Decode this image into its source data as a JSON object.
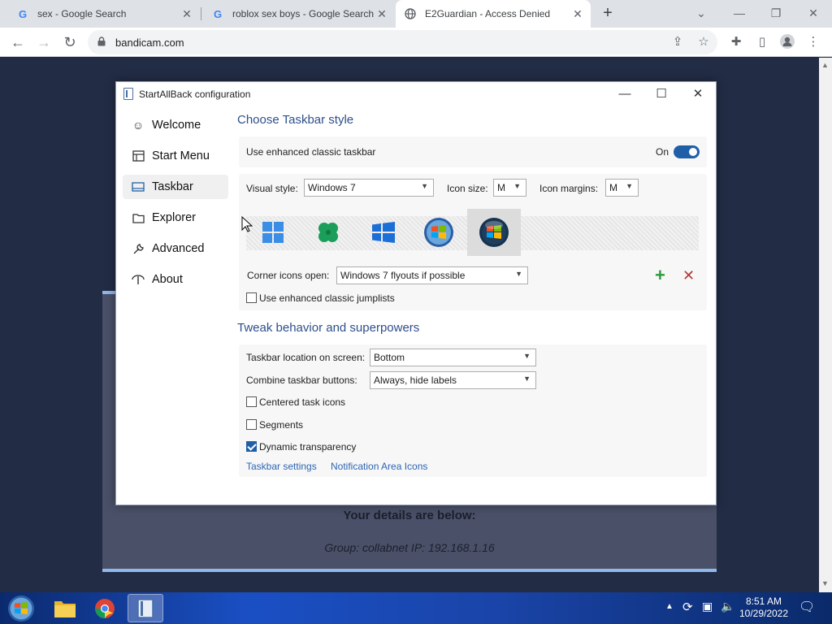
{
  "browser": {
    "tabs": [
      {
        "title": "sex - Google Search",
        "favicon": "G"
      },
      {
        "title": "roblox sex boys - Google Search",
        "favicon": "G"
      },
      {
        "title": "E2Guardian - Access Denied",
        "favicon": "globe"
      }
    ],
    "url": "bandicam.com"
  },
  "background_page": {
    "details_heading": "Your details are below:",
    "group_line": "Group: collabnet    IP: 192.168.1.16"
  },
  "dialog": {
    "title": "StartAllBack configuration",
    "nav": [
      {
        "label": "Welcome",
        "icon": "smile-icon"
      },
      {
        "label": "Start Menu",
        "icon": "start-menu-icon"
      },
      {
        "label": "Taskbar",
        "icon": "taskbar-icon"
      },
      {
        "label": "Explorer",
        "icon": "folder-icon"
      },
      {
        "label": "Advanced",
        "icon": "wrench-icon"
      },
      {
        "label": "About",
        "icon": "about-icon"
      }
    ],
    "taskbar_section": {
      "title": "Choose Taskbar style",
      "enhanced_label": "Use enhanced classic taskbar",
      "enhanced_state": "On",
      "visual_style_label": "Visual style:",
      "visual_style_value": "Windows 7",
      "icon_size_label": "Icon size:",
      "icon_size_value": "M",
      "icon_margins_label": "Icon margins:",
      "icon_margins_value": "M",
      "corner_label": "Corner icons open:",
      "corner_value": "Windows 7 flyouts if possible",
      "jumplists_label": "Use enhanced classic jumplists"
    },
    "tweak_section": {
      "title": "Tweak behavior and superpowers",
      "location_label": "Taskbar location on screen:",
      "location_value": "Bottom",
      "combine_label": "Combine taskbar buttons:",
      "combine_value": "Always, hide labels",
      "centered_label": "Centered task icons",
      "segments_label": "Segments",
      "dynamic_label": "Dynamic transparency",
      "link_settings": "Taskbar settings",
      "link_notification": "Notification Area Icons"
    }
  },
  "taskbar": {
    "time": "8:51 AM",
    "date": "10/29/2022"
  },
  "colors": {
    "accent": "#1f5fa8",
    "section_title": "#2d4f8c",
    "link": "#2d64b4"
  }
}
